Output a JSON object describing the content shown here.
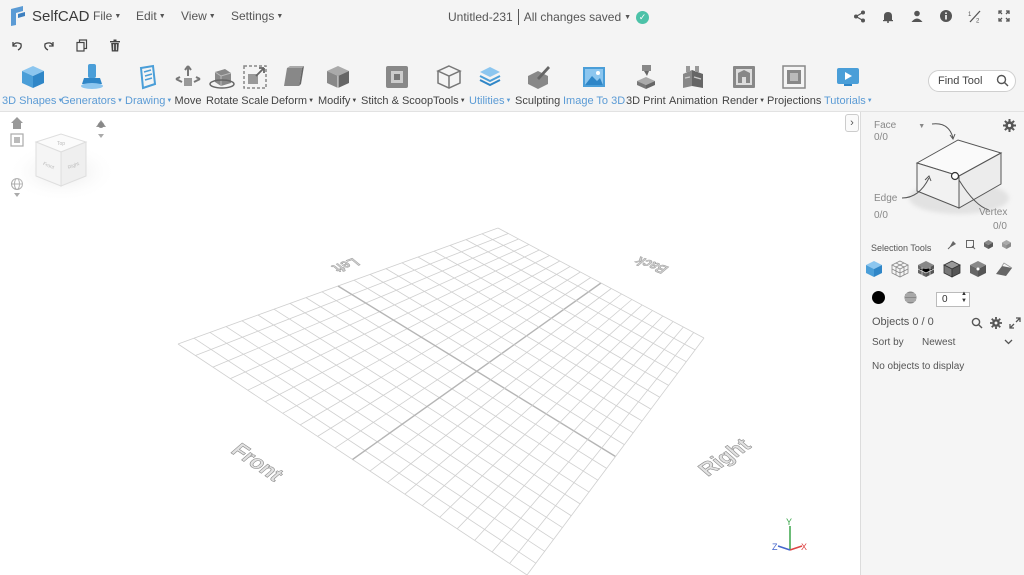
{
  "app": {
    "name": "SelfCAD"
  },
  "menu": {
    "file": "File",
    "edit": "Edit",
    "view": "View",
    "settings": "Settings"
  },
  "document": {
    "title": "Untitled-231",
    "status": "All changes saved"
  },
  "toolbar": {
    "tools": [
      {
        "label": "3D Shapes",
        "icon": "cube-icon"
      },
      {
        "label": "Generators",
        "icon": "generator-icon"
      },
      {
        "label": "Drawing",
        "icon": "drawing-icon"
      },
      {
        "label": "Move",
        "icon": "move-icon"
      },
      {
        "label": "Rotate",
        "icon": "rotate-icon"
      },
      {
        "label": "Scale",
        "icon": "scale-icon"
      },
      {
        "label": "Deform",
        "icon": "deform-icon"
      },
      {
        "label": "Modify",
        "icon": "modify-icon"
      },
      {
        "label": "Stitch & Scoop",
        "icon": "stitch-icon"
      },
      {
        "label": "Tools",
        "icon": "tools-icon"
      },
      {
        "label": "Utilities",
        "icon": "utilities-icon"
      },
      {
        "label": "Sculpting",
        "icon": "sculpting-icon"
      },
      {
        "label": "Image To 3D",
        "icon": "image-icon"
      },
      {
        "label": "3D Print",
        "icon": "printer-icon"
      },
      {
        "label": "Animation",
        "icon": "animation-icon"
      },
      {
        "label": "Render",
        "icon": "render-icon"
      },
      {
        "label": "Projections",
        "icon": "projections-icon"
      },
      {
        "label": "Tutorials",
        "icon": "tutorials-icon"
      }
    ],
    "find_tool": "Find Tool"
  },
  "viewport": {
    "labels": {
      "left": "Left",
      "back": "Back",
      "front": "Front",
      "right": "Right"
    },
    "axes": {
      "x": "X",
      "y": "Y",
      "z": "Z"
    },
    "viewcube": {
      "top": "Top",
      "front": "Front",
      "right": "Right"
    }
  },
  "panel": {
    "face": "Face",
    "face_count": "0/0",
    "edge": "Edge",
    "edge_count": "0/0",
    "vertex": "Vertex",
    "vertex_count": "0/0",
    "selection_tools": "Selection Tools",
    "quantity": "0",
    "objects": "Objects 0 / 0",
    "sort_by": "Sort by",
    "sort_value": "Newest",
    "empty": "No objects to display"
  },
  "colors": {
    "accent_blue": "#5b9bd5",
    "saved_green": "#4cc2a8"
  }
}
